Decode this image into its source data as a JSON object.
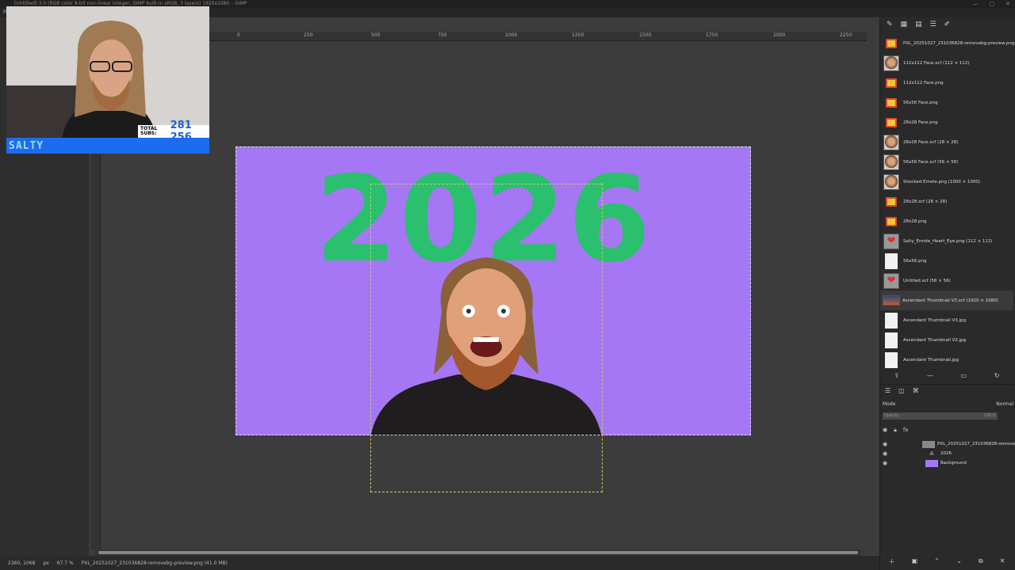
{
  "window": {
    "title": "[Untitled]-3.0 (RGB color 8-bit non-linear integer, GIMP built-in sRGB, 3 layers) 1920x1080 – GIMP",
    "controls": [
      "—",
      "▢",
      "✕"
    ]
  },
  "menubar": {
    "items": [
      "File"
    ]
  },
  "ruler": {
    "labels": [
      "0",
      "250",
      "500",
      "750",
      "1000",
      "1250",
      "1500",
      "1750",
      "2000",
      "2250"
    ]
  },
  "canvas": {
    "image_text": "2026",
    "colors": {
      "background": "#a577f5",
      "text": "#2ac06d"
    }
  },
  "webcam": {
    "subs_label": "TOTAL SUBS:",
    "subs_count": "281 256",
    "channel_name": "SALTY"
  },
  "images_panel": {
    "items": [
      {
        "name": "PXL_20251027_231036828-removebg-preview.png",
        "thumb": "emoji"
      },
      {
        "name": "112x112 Face.xcf (112 × 112)",
        "thumb": "face"
      },
      {
        "name": "112x112 Face.png",
        "thumb": "emoji"
      },
      {
        "name": "56x56 Face.png",
        "thumb": "emoji"
      },
      {
        "name": "28x28 Face.png",
        "thumb": "emoji"
      },
      {
        "name": "28x28 Face.xcf (28 × 28)",
        "thumb": "face"
      },
      {
        "name": "56x56 Face.xcf (56 × 56)",
        "thumb": "face"
      },
      {
        "name": "Shocked Emote.png (1000 × 1000)",
        "thumb": "face"
      },
      {
        "name": "28x28.xcf (28 × 28)",
        "thumb": "emoji"
      },
      {
        "name": "28x28.png",
        "thumb": "emoji"
      },
      {
        "name": "Salty_Emote_Heart_Eye.png (112 × 112)",
        "thumb": "heart"
      },
      {
        "name": "56x56.png",
        "thumb": "blank"
      },
      {
        "name": "Untitled.xcf (56 × 56)",
        "thumb": "heart"
      },
      {
        "name": "Ascendant Thumbnail V3.xcf (1920 × 1080)",
        "thumb": "landscape"
      },
      {
        "name": "Ascendant Thumbnail V3.jpg",
        "thumb": "blank"
      },
      {
        "name": "Ascendant Thumbnail V2.jpg",
        "thumb": "blank"
      },
      {
        "name": "Ascendant Thumbnail.jpg",
        "thumb": "blank"
      }
    ],
    "active_index": 13
  },
  "layers_panel": {
    "mode_label": "Mode",
    "mode_value": "Normal",
    "opacity_label": "Opacity",
    "opacity_value": "100.0",
    "layers": [
      {
        "name": "PXL_20251027_231036828-removebg",
        "swatch": "#888888"
      },
      {
        "name": "2026",
        "swatch": "text"
      },
      {
        "name": "Background",
        "swatch": "#a577f5"
      }
    ]
  },
  "statusbar": {
    "coords": "2360, 1068",
    "unit": "px",
    "zoom": "67.7 %",
    "info": "PXL_20251027_231036828-removebg-preview.png (41.0 MB)"
  }
}
